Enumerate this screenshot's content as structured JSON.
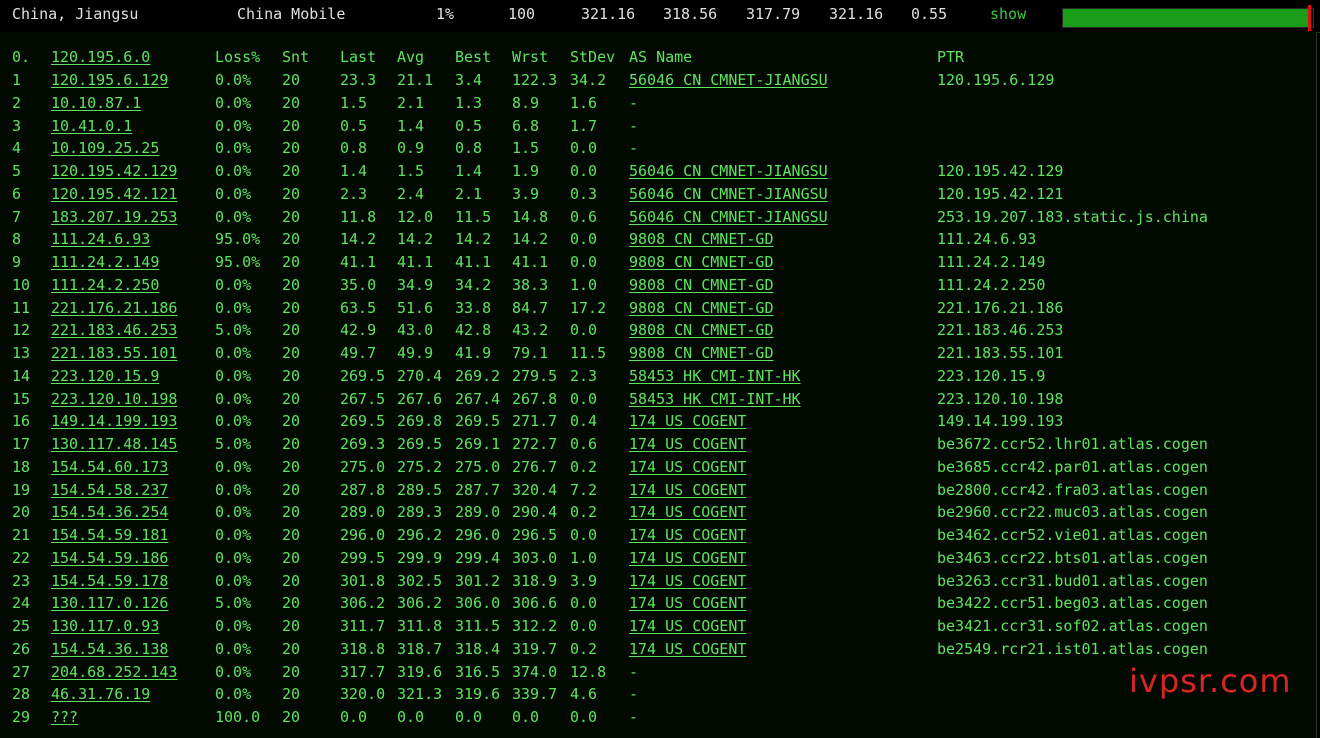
{
  "summary": {
    "location": "China, Jiangsu",
    "isp": "China Mobile",
    "loss": "1%",
    "sent": "100",
    "last": "321.16",
    "avg": "318.56",
    "best": "317.79",
    "worst": "321.16",
    "stdev": "0.55",
    "show_label": "show",
    "progress": 0.99,
    "progress_color": "#1a9e1a",
    "marker_color": "#e01010"
  },
  "table": {
    "headers": {
      "num": "0.",
      "host": "120.195.6.0",
      "loss": "Loss%",
      "snt": "Snt",
      "last": "Last",
      "avg": "Avg",
      "best": "Best",
      "wrst": "Wrst",
      "stdev": "StDev",
      "as": "AS Name",
      "ptr": "PTR"
    },
    "rows": [
      {
        "num": "1",
        "host": "120.195.6.129",
        "loss": "0.0%",
        "snt": "20",
        "last": "23.3",
        "avg": "21.1",
        "best": "3.4",
        "wrst": "122.3",
        "stdev": "34.2",
        "as": "56046 CN CMNET-JIANGSU",
        "ptr": "120.195.6.129"
      },
      {
        "num": "2",
        "host": "10.10.87.1",
        "loss": "0.0%",
        "snt": "20",
        "last": "1.5",
        "avg": "2.1",
        "best": "1.3",
        "wrst": "8.9",
        "stdev": "1.6",
        "as": "-",
        "ptr": ""
      },
      {
        "num": "3",
        "host": "10.41.0.1",
        "loss": "0.0%",
        "snt": "20",
        "last": "0.5",
        "avg": "1.4",
        "best": "0.5",
        "wrst": "6.8",
        "stdev": "1.7",
        "as": "-",
        "ptr": ""
      },
      {
        "num": "4",
        "host": "10.109.25.25",
        "loss": "0.0%",
        "snt": "20",
        "last": "0.8",
        "avg": "0.9",
        "best": "0.8",
        "wrst": "1.5",
        "stdev": "0.0",
        "as": "-",
        "ptr": ""
      },
      {
        "num": "5",
        "host": "120.195.42.129",
        "loss": "0.0%",
        "snt": "20",
        "last": "1.4",
        "avg": "1.5",
        "best": "1.4",
        "wrst": "1.9",
        "stdev": "0.0",
        "as": "56046 CN CMNET-JIANGSU",
        "ptr": "120.195.42.129"
      },
      {
        "num": "6",
        "host": "120.195.42.121",
        "loss": "0.0%",
        "snt": "20",
        "last": "2.3",
        "avg": "2.4",
        "best": "2.1",
        "wrst": "3.9",
        "stdev": "0.3",
        "as": "56046 CN CMNET-JIANGSU",
        "ptr": "120.195.42.121"
      },
      {
        "num": "7",
        "host": "183.207.19.253",
        "loss": "0.0%",
        "snt": "20",
        "last": "11.8",
        "avg": "12.0",
        "best": "11.5",
        "wrst": "14.8",
        "stdev": "0.6",
        "as": "56046 CN CMNET-JIANGSU",
        "ptr": "253.19.207.183.static.js.china"
      },
      {
        "num": "8",
        "host": "111.24.6.93",
        "loss": "95.0%",
        "snt": "20",
        "last": "14.2",
        "avg": "14.2",
        "best": "14.2",
        "wrst": "14.2",
        "stdev": "0.0",
        "as": "9808  CN CMNET-GD",
        "ptr": "111.24.6.93"
      },
      {
        "num": "9",
        "host": "111.24.2.149",
        "loss": "95.0%",
        "snt": "20",
        "last": "41.1",
        "avg": "41.1",
        "best": "41.1",
        "wrst": "41.1",
        "stdev": "0.0",
        "as": "9808  CN CMNET-GD",
        "ptr": "111.24.2.149"
      },
      {
        "num": "10",
        "host": "111.24.2.250",
        "loss": "0.0%",
        "snt": "20",
        "last": "35.0",
        "avg": "34.9",
        "best": "34.2",
        "wrst": "38.3",
        "stdev": "1.0",
        "as": "9808  CN CMNET-GD",
        "ptr": "111.24.2.250"
      },
      {
        "num": "11",
        "host": "221.176.21.186",
        "loss": "0.0%",
        "snt": "20",
        "last": "63.5",
        "avg": "51.6",
        "best": "33.8",
        "wrst": "84.7",
        "stdev": "17.2",
        "as": "9808  CN CMNET-GD",
        "ptr": "221.176.21.186"
      },
      {
        "num": "12",
        "host": "221.183.46.253",
        "loss": "5.0%",
        "snt": "20",
        "last": "42.9",
        "avg": "43.0",
        "best": "42.8",
        "wrst": "43.2",
        "stdev": "0.0",
        "as": "9808  CN CMNET-GD",
        "ptr": "221.183.46.253"
      },
      {
        "num": "13",
        "host": "221.183.55.101",
        "loss": "0.0%",
        "snt": "20",
        "last": "49.7",
        "avg": "49.9",
        "best": "41.9",
        "wrst": "79.1",
        "stdev": "11.5",
        "as": "9808  CN CMNET-GD",
        "ptr": "221.183.55.101"
      },
      {
        "num": "14",
        "host": "223.120.15.9",
        "loss": "0.0%",
        "snt": "20",
        "last": "269.5",
        "avg": "270.4",
        "best": "269.2",
        "wrst": "279.5",
        "stdev": "2.3",
        "as": "58453 HK CMI-INT-HK",
        "ptr": "223.120.15.9"
      },
      {
        "num": "15",
        "host": "223.120.10.198",
        "loss": "0.0%",
        "snt": "20",
        "last": "267.5",
        "avg": "267.6",
        "best": "267.4",
        "wrst": "267.8",
        "stdev": "0.0",
        "as": "58453 HK CMI-INT-HK",
        "ptr": "223.120.10.198"
      },
      {
        "num": "16",
        "host": "149.14.199.193",
        "loss": "0.0%",
        "snt": "20",
        "last": "269.5",
        "avg": "269.8",
        "best": "269.5",
        "wrst": "271.7",
        "stdev": "0.4",
        "as": "174   US COGENT",
        "ptr": "149.14.199.193"
      },
      {
        "num": "17",
        "host": "130.117.48.145",
        "loss": "5.0%",
        "snt": "20",
        "last": "269.3",
        "avg": "269.5",
        "best": "269.1",
        "wrst": "272.7",
        "stdev": "0.6",
        "as": "174   US COGENT",
        "ptr": "be3672.ccr52.lhr01.atlas.cogen"
      },
      {
        "num": "18",
        "host": "154.54.60.173",
        "loss": "0.0%",
        "snt": "20",
        "last": "275.0",
        "avg": "275.2",
        "best": "275.0",
        "wrst": "276.7",
        "stdev": "0.2",
        "as": "174   US COGENT",
        "ptr": "be3685.ccr42.par01.atlas.cogen"
      },
      {
        "num": "19",
        "host": "154.54.58.237",
        "loss": "0.0%",
        "snt": "20",
        "last": "287.8",
        "avg": "289.5",
        "best": "287.7",
        "wrst": "320.4",
        "stdev": "7.2",
        "as": "174   US COGENT",
        "ptr": "be2800.ccr42.fra03.atlas.cogen"
      },
      {
        "num": "20",
        "host": "154.54.36.254",
        "loss": "0.0%",
        "snt": "20",
        "last": "289.0",
        "avg": "289.3",
        "best": "289.0",
        "wrst": "290.4",
        "stdev": "0.2",
        "as": "174   US COGENT",
        "ptr": "be2960.ccr22.muc03.atlas.cogen"
      },
      {
        "num": "21",
        "host": "154.54.59.181",
        "loss": "0.0%",
        "snt": "20",
        "last": "296.0",
        "avg": "296.2",
        "best": "296.0",
        "wrst": "296.5",
        "stdev": "0.0",
        "as": "174   US COGENT",
        "ptr": "be3462.ccr52.vie01.atlas.cogen"
      },
      {
        "num": "22",
        "host": "154.54.59.186",
        "loss": "0.0%",
        "snt": "20",
        "last": "299.5",
        "avg": "299.9",
        "best": "299.4",
        "wrst": "303.0",
        "stdev": "1.0",
        "as": "174   US COGENT",
        "ptr": "be3463.ccr22.bts01.atlas.cogen"
      },
      {
        "num": "23",
        "host": "154.54.59.178",
        "loss": "0.0%",
        "snt": "20",
        "last": "301.8",
        "avg": "302.5",
        "best": "301.2",
        "wrst": "318.9",
        "stdev": "3.9",
        "as": "174   US COGENT",
        "ptr": "be3263.ccr31.bud01.atlas.cogen"
      },
      {
        "num": "24",
        "host": "130.117.0.126",
        "loss": "5.0%",
        "snt": "20",
        "last": "306.2",
        "avg": "306.2",
        "best": "306.0",
        "wrst": "306.6",
        "stdev": "0.0",
        "as": "174   US COGENT",
        "ptr": "be3422.ccr51.beg03.atlas.cogen"
      },
      {
        "num": "25",
        "host": "130.117.0.93",
        "loss": "0.0%",
        "snt": "20",
        "last": "311.7",
        "avg": "311.8",
        "best": "311.5",
        "wrst": "312.2",
        "stdev": "0.0",
        "as": "174   US COGENT",
        "ptr": "be3421.ccr31.sof02.atlas.cogen"
      },
      {
        "num": "26",
        "host": "154.54.36.138",
        "loss": "0.0%",
        "snt": "20",
        "last": "318.8",
        "avg": "318.7",
        "best": "318.4",
        "wrst": "319.7",
        "stdev": "0.2",
        "as": "174   US COGENT",
        "ptr": "be2549.rcr21.ist01.atlas.cogen"
      },
      {
        "num": "27",
        "host": "204.68.252.143",
        "loss": "0.0%",
        "snt": "20",
        "last": "317.7",
        "avg": "319.6",
        "best": "316.5",
        "wrst": "374.0",
        "stdev": "12.8",
        "as": "-",
        "ptr": ""
      },
      {
        "num": "28",
        "host": "46.31.76.19",
        "loss": "0.0%",
        "snt": "20",
        "last": "320.0",
        "avg": "321.3",
        "best": "319.6",
        "wrst": "339.7",
        "stdev": "4.6",
        "as": "-",
        "ptr": ""
      },
      {
        "num": "29",
        "host": "???",
        "loss": "100.0",
        "snt": "20",
        "last": "0.0",
        "avg": "0.0",
        "best": "0.0",
        "wrst": "0.0",
        "stdev": "0.0",
        "as": "-",
        "ptr": ""
      }
    ]
  },
  "watermark": "ivpsr.com",
  "colors": {
    "text_green": "#5fe35f",
    "background": "#020a02",
    "watermark_red": "#ff2a2a"
  }
}
